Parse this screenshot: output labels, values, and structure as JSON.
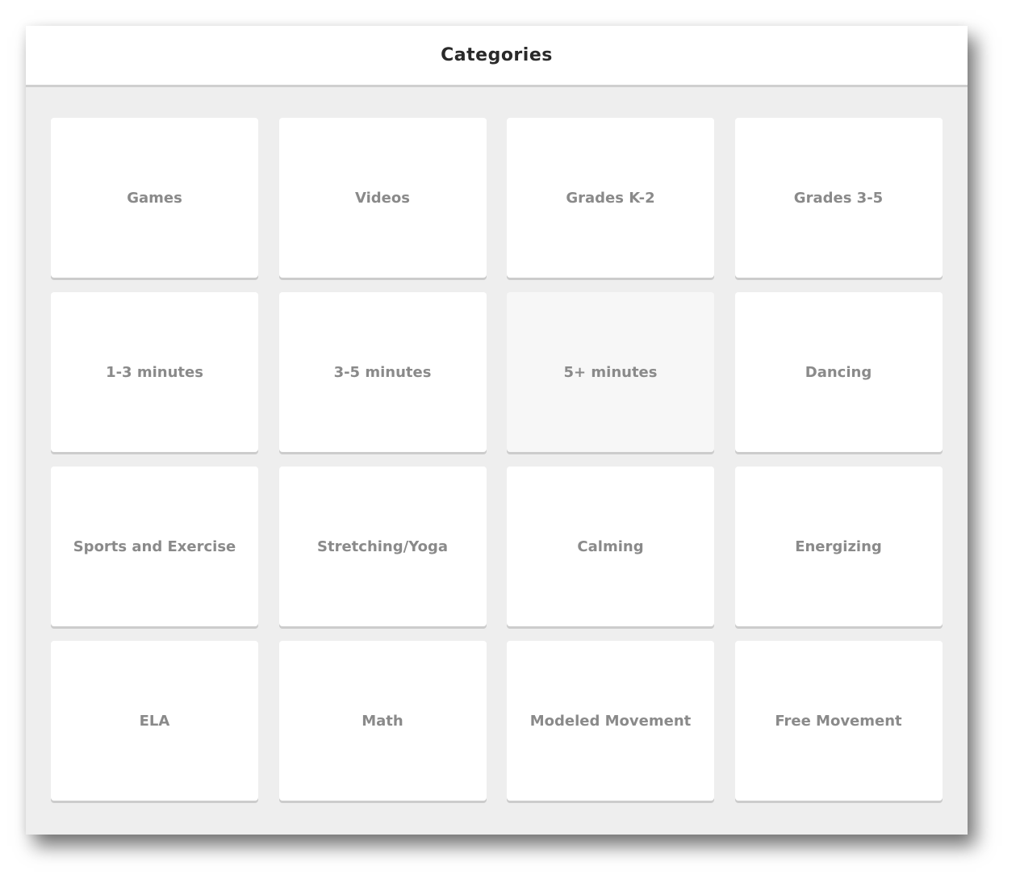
{
  "header": {
    "title": "Categories"
  },
  "categories": [
    {
      "label": "Games"
    },
    {
      "label": "Videos"
    },
    {
      "label": "Grades K-2"
    },
    {
      "label": "Grades 3-5"
    },
    {
      "label": "1-3 minutes"
    },
    {
      "label": "3-5 minutes"
    },
    {
      "label": "5+ minutes",
      "state": "hovered"
    },
    {
      "label": "Dancing"
    },
    {
      "label": "Sports and Exercise"
    },
    {
      "label": "Stretching/Yoga"
    },
    {
      "label": "Calming"
    },
    {
      "label": "Energizing"
    },
    {
      "label": "ELA"
    },
    {
      "label": "Math"
    },
    {
      "label": "Modeled Movement"
    },
    {
      "label": "Free Movement"
    }
  ],
  "colors": {
    "background": "#eeeeee",
    "tile": "#ffffff",
    "tile_hover": "#f7f7f7",
    "tile_text": "#8a8a8a",
    "title_text": "#2a2a2a"
  }
}
